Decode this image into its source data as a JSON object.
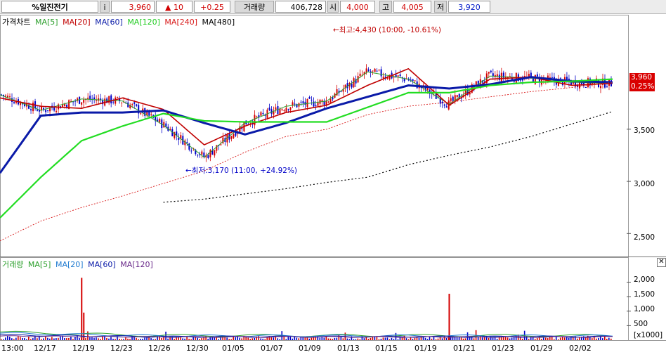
{
  "toolbar": {
    "stock_name": "%일진전기",
    "info_label": "i",
    "price": "3,960",
    "change": "▲ 10",
    "rate": "+0.25",
    "volume_label": "거래량",
    "volume": "406,728",
    "open_label": "시",
    "open": "4,000",
    "high_label": "고",
    "high": "4,005",
    "low_label": "저",
    "low": "3,920"
  },
  "price_panel": {
    "title": "가격차트",
    "legend": [
      "MA[5]",
      "MA[20]",
      "MA[60]",
      "MA[120]",
      "MA[240]",
      "MA[480]"
    ],
    "annotation_high": "←최고:4,430 (10:00, -10.61%)",
    "annotation_low": "←최저:3,170 (11:00, +24.92%)",
    "last_price_tag": "3,960",
    "last_rate_tag": "0.25%",
    "y_ticks": [
      "3,500",
      "3,000",
      "2,500"
    ]
  },
  "volume_panel": {
    "title": "거래량",
    "legend": [
      "MA[5]",
      "MA[20]",
      "MA[60]",
      "MA[120]"
    ],
    "y_ticks": [
      "2,000",
      "1,500",
      "1,000",
      "500"
    ],
    "unit": "[x1000]",
    "close_glyph": "✕"
  },
  "x_ticks": [
    "13:00",
    "12/17",
    "12/19",
    "12/23",
    "12/26",
    "12/30",
    "01/05",
    "01/07",
    "01/09",
    "01/13",
    "01/15",
    "01/19",
    "01/21",
    "01/23",
    "01/29",
    "02/02"
  ],
  "colors": {
    "ma5": "#2ea02e",
    "ma20": "#c00000",
    "ma60": "#0a1aa8",
    "ma120": "#22dd22",
    "ma240": "#d81818",
    "ma480": "#000000",
    "candle_up": "#d40000",
    "candle_down": "#0000c8"
  },
  "chart_data": {
    "type": "line",
    "title": "가격차트",
    "x": [
      "13:00",
      "12/17",
      "12/19",
      "12/23",
      "12/26",
      "12/30",
      "01/05",
      "01/07",
      "01/09",
      "01/13",
      "01/15",
      "01/19",
      "01/21",
      "01/23",
      "01/29",
      "02/02"
    ],
    "series": [
      {
        "name": "MA[5]",
        "values": [
          3830,
          3680,
          3790,
          3770,
          3540,
          3230,
          3560,
          3720,
          3770,
          4050,
          3980,
          3740,
          4010,
          3990,
          3950,
          3940
        ]
      },
      {
        "name": "MA[20]",
        "values": [
          3800,
          3720,
          3700,
          3800,
          3690,
          3350,
          3530,
          3660,
          3730,
          3920,
          4080,
          3730,
          3980,
          4000,
          3920,
          3940
        ]
      },
      {
        "name": "MA[60]",
        "values": [
          3080,
          3630,
          3660,
          3660,
          3680,
          3560,
          3450,
          3560,
          3700,
          3810,
          3920,
          3890,
          3930,
          4000,
          3960,
          3950
        ]
      },
      {
        "name": "MA[120]",
        "values": [
          2650,
          3040,
          3390,
          3530,
          3650,
          3580,
          3570,
          3570,
          3570,
          3710,
          3850,
          3850,
          3920,
          3950,
          3960,
          3980
        ]
      },
      {
        "name": "MA[240]",
        "values": [
          2430,
          2620,
          2750,
          2860,
          2980,
          3100,
          3280,
          3430,
          3500,
          3640,
          3720,
          3760,
          3810,
          3860,
          3900,
          3950
        ]
      },
      {
        "name": "MA[480]",
        "values": [
          null,
          null,
          null,
          null,
          2800,
          2830,
          2880,
          2930,
          2990,
          3040,
          3160,
          3250,
          3330,
          3430,
          3550,
          3670
        ]
      }
    ],
    "ylim": [
      2300,
      4550
    ],
    "annotations": [
      {
        "text": "최고:4,430 (10:00, -10.61%)",
        "value": 4430
      },
      {
        "text": "최저:3,170 (11:00, +24.92%)",
        "value": 3170
      }
    ],
    "volume": {
      "unit": "x1000",
      "ylim": [
        0,
        2400
      ],
      "peaks": [
        {
          "x": "12/19",
          "value": 2150
        },
        {
          "x": "01/19",
          "value": 1600
        },
        {
          "x": "12/19",
          "value": 950
        }
      ]
    }
  }
}
